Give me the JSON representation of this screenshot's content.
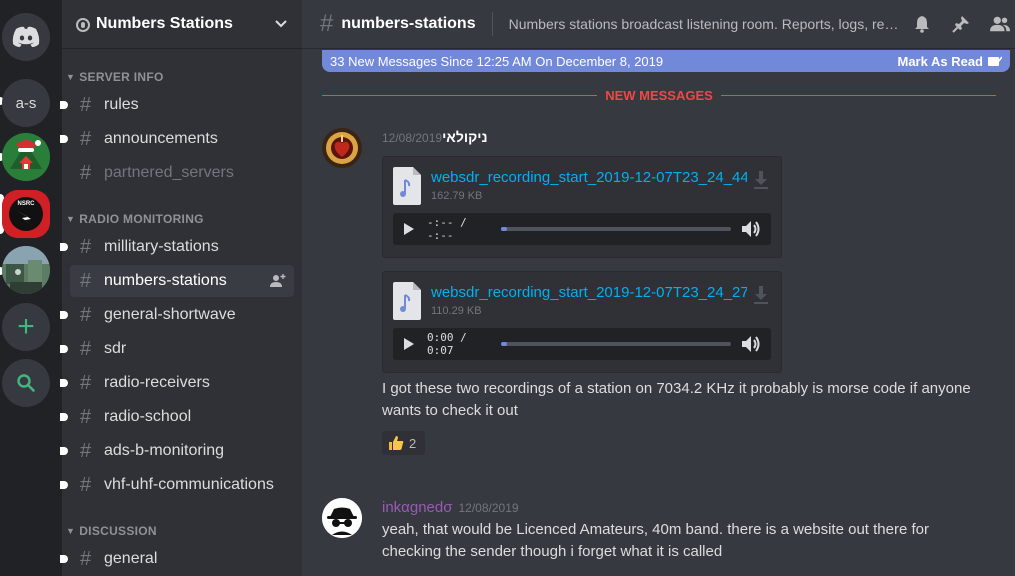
{
  "servers": {
    "abbrev": "a-s",
    "nsrc_label": "NSRC",
    "add_glyph": "+"
  },
  "guild": {
    "name": "Numbers Stations"
  },
  "categories": {
    "server_info": "SERVER INFO",
    "radio_monitoring": "RADIO MONITORING",
    "discussion": "DISCUSSION"
  },
  "channels": {
    "rules": "rules",
    "announcements": "announcements",
    "partnered_servers": "partnered_servers",
    "military_stations": "millitary-stations",
    "numbers_stations": "numbers-stations",
    "general_shortwave": "general-shortwave",
    "sdr": "sdr",
    "radio_receivers": "radio-receivers",
    "radio_school": "radio-school",
    "ads_b_monitoring": "ads-b-monitoring",
    "vhf_uhf": "vhf-uhf-communications",
    "general": "general"
  },
  "topbar": {
    "channel_name": "numbers-stations",
    "topic": "Numbers stations broadcast listening room. Reports, logs, recordings..."
  },
  "new_messages_bar": {
    "text": "33 New Messages Since 12:25 AM On December 8, 2019",
    "mark_read": "Mark As Read"
  },
  "divider_label": "NEW MESSAGES",
  "messages": [
    {
      "author": "ניקולאי",
      "timestamp": "12/08/2019",
      "author_color": "#ffffff",
      "attachments": [
        {
          "filename": "websdr_recording_start_2019-12-07T23_24_44",
          "size": "162.79 KB",
          "time": "-:-- / -:--",
          "progress": 0
        },
        {
          "filename": "websdr_recording_start_2019-12-07T23_24_27",
          "size": "110.29 KB",
          "time": "0:00 / 0:07",
          "progress": 0
        }
      ],
      "text": "I got these two recordings of a station on 7034.2 KHz it probably is morse code if anyone wants to check it out",
      "reaction": {
        "emoji": "thumbs-up",
        "count": "2"
      }
    },
    {
      "author": "inkαgnedσ",
      "timestamp": "12/08/2019",
      "author_color": "#9b59b6",
      "text": "yeah, that would be Licenced Amateurs, 40m band. there is a website out there for checking the sender though i forget what it is called"
    }
  ],
  "colors": {
    "blurple": "#7289da",
    "red": "#f04747",
    "link": "#00b0f4",
    "green": "#43b581"
  }
}
